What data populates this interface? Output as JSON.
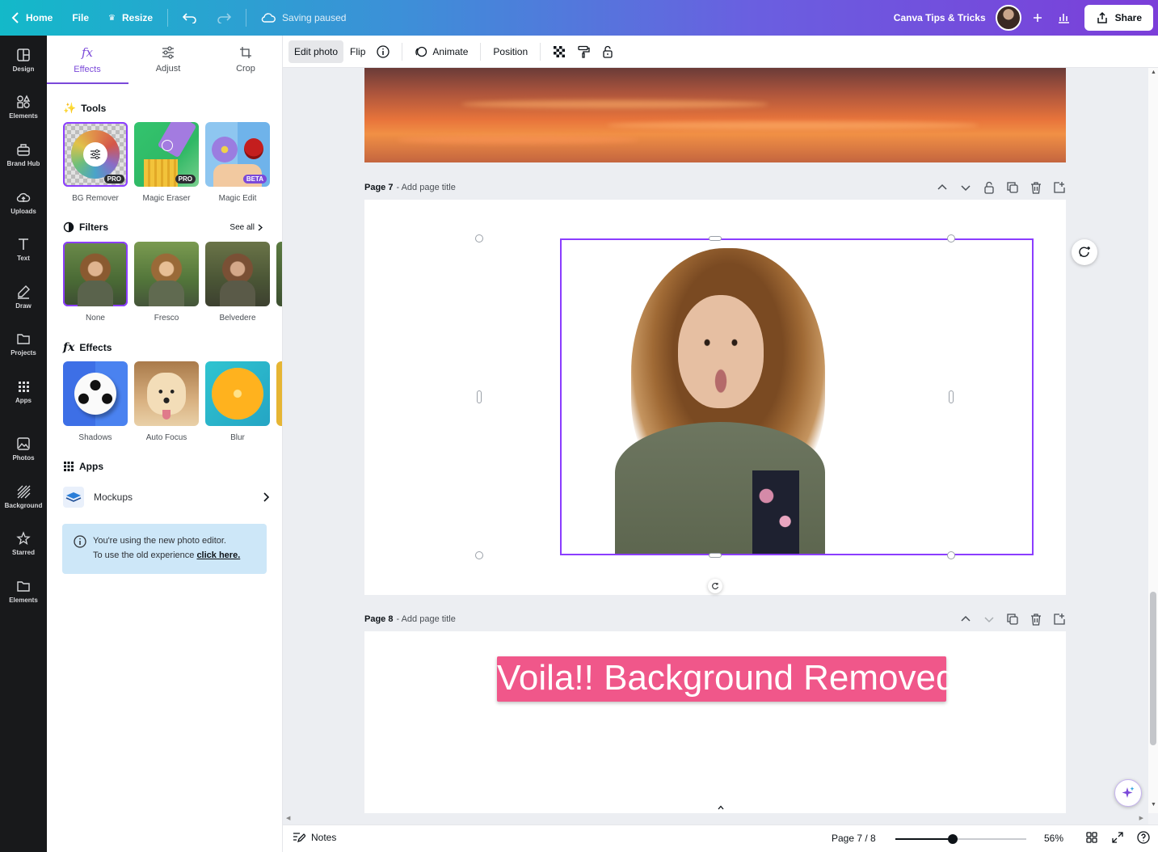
{
  "topbar": {
    "home": "Home",
    "file": "File",
    "resize": "Resize",
    "status": "Saving paused",
    "team": "Canva Tips & Tricks",
    "share": "Share"
  },
  "rail": [
    "Design",
    "Elements",
    "Brand Hub",
    "Uploads",
    "Text",
    "Draw",
    "Projects",
    "Apps",
    "Photos",
    "Background",
    "Starred",
    "Elements"
  ],
  "panel": {
    "tabs": [
      "Effects",
      "Adjust",
      "Crop"
    ],
    "tools_heading": "Tools",
    "tools": [
      {
        "label": "BG Remover",
        "badge": "PRO"
      },
      {
        "label": "Magic Eraser",
        "badge": "PRO"
      },
      {
        "label": "Magic Edit",
        "badge": "BETA"
      }
    ],
    "filters_heading": "Filters",
    "see_all": "See all",
    "filters": [
      "None",
      "Fresco",
      "Belvedere"
    ],
    "effects_heading": "Effects",
    "effects": [
      "Shadows",
      "Auto Focus",
      "Blur"
    ],
    "apps_heading": "Apps",
    "mockups": "Mockups",
    "info_line1": "You're using the new photo editor.",
    "info_line2": "To use the old experience",
    "info_link": "click here."
  },
  "ctx": {
    "edit_photo": "Edit photo",
    "flip": "Flip",
    "animate": "Animate",
    "position": "Position"
  },
  "canvas": {
    "page7_label": "Page 7",
    "page7_title": "- Add page title",
    "page8_label": "Page 8",
    "page8_title": "- Add page title",
    "banner": "Voila!! Background Removed"
  },
  "bottom": {
    "notes": "Notes",
    "page_indicator": "Page 7 / 8",
    "zoom": "56%",
    "zoom_fraction": 0.44
  },
  "colors": {
    "accent": "#8b3dff",
    "banner": "#f0578a",
    "rail": "#18191b"
  }
}
